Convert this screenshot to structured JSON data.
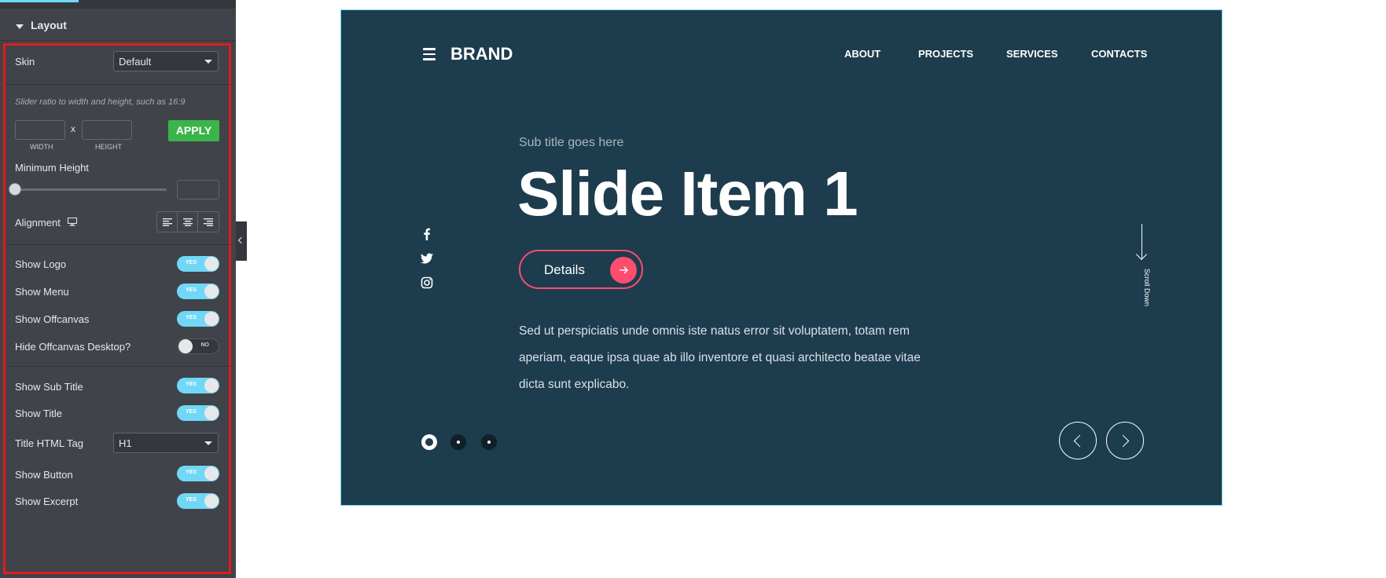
{
  "panel": {
    "section_title": "Layout",
    "skin": {
      "label": "Skin",
      "value": "Default"
    },
    "ratio_hint": "Slider ratio to width and height, such as 16:9",
    "width_label": "WIDTH",
    "height_label": "HEIGHT",
    "times": "x",
    "apply_label": "APPLY",
    "min_height_label": "Minimum Height",
    "alignment_label": "Alignment",
    "toggles_a": [
      {
        "label": "Show Logo",
        "state": "YES"
      },
      {
        "label": "Show Menu",
        "state": "YES"
      },
      {
        "label": "Show Offcanvas",
        "state": "YES"
      },
      {
        "label": "Hide Offcanvas Desktop?",
        "state": "NO"
      }
    ],
    "toggles_b": [
      {
        "label": "Show Sub Title",
        "state": "YES"
      },
      {
        "label": "Show Title",
        "state": "YES"
      }
    ],
    "title_tag": {
      "label": "Title HTML Tag",
      "value": "H1"
    },
    "toggles_c": [
      {
        "label": "Show Button",
        "state": "YES"
      },
      {
        "label": "Show Excerpt",
        "state": "YES"
      }
    ]
  },
  "preview": {
    "brand": "BRAND",
    "nav": [
      "ABOUT",
      "PROJECTS",
      "SERVICES",
      "CONTACTS"
    ],
    "subtitle": "Sub title goes here",
    "title": "Slide Item 1",
    "button_label": "Details",
    "excerpt_lines": [
      "Sed ut perspiciatis unde omnis iste natus error sit voluptatem, totam rem",
      "aperiam, eaque ipsa quae ab illo inventore et quasi architecto beatae vitae",
      "dicta sunt explicabo."
    ],
    "scroll_text": "Scroll Down",
    "social_icons": [
      "facebook-icon",
      "twitter-icon",
      "instagram-icon"
    ],
    "pagination": {
      "count": 3,
      "active": 1
    },
    "colors": {
      "background": "#1d3c4e",
      "accent": "#ff4d6d",
      "toggle_on": "#71d7f7",
      "apply": "#39b54a"
    }
  }
}
